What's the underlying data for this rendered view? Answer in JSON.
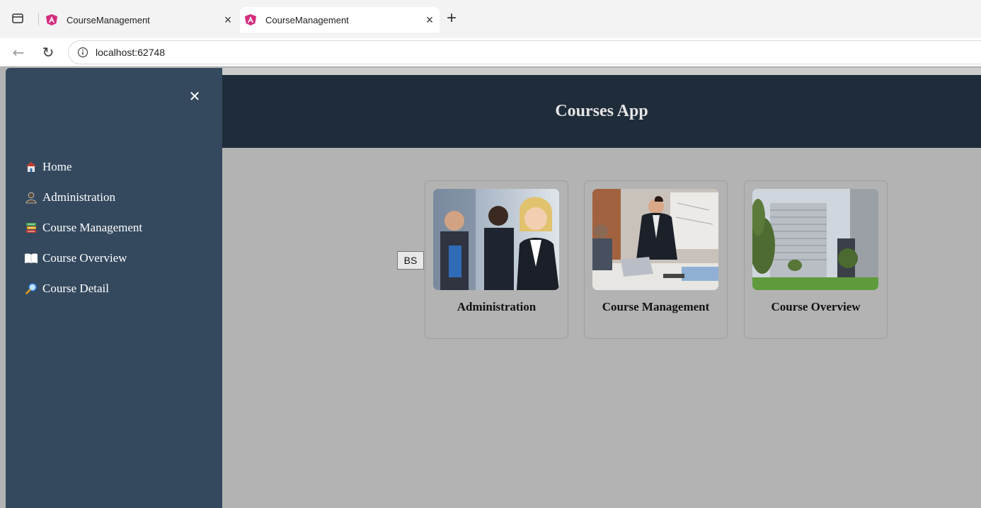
{
  "browser": {
    "tabs": [
      {
        "title": "CourseManagement",
        "active": false
      },
      {
        "title": "CourseManagement",
        "active": true
      }
    ],
    "new_tab_glyph": "+",
    "close_glyph": "×",
    "url": "localhost:62748"
  },
  "app": {
    "title": "Courses App",
    "sidebar": {
      "close_glyph": "✕",
      "items": [
        {
          "label": "Home",
          "icon": "house-icon"
        },
        {
          "label": "Administration",
          "icon": "person-silhouette-icon"
        },
        {
          "label": "Course Management",
          "icon": "books-icon"
        },
        {
          "label": "Course Overview",
          "icon": "open-book-icon"
        },
        {
          "label": "Course Detail",
          "icon": "magnifier-icon"
        }
      ]
    },
    "bs_button_label": "BS",
    "cards": [
      {
        "caption": "Administration",
        "image": "business-team-photo"
      },
      {
        "caption": "Course Management",
        "image": "meeting-laptop-photo"
      },
      {
        "caption": "Course Overview",
        "image": "office-building-photo"
      }
    ]
  },
  "colors": {
    "sidebar_bg": "#34495e",
    "header_bg": "#1f2c3a",
    "content_bg": "#b3b3b3"
  }
}
